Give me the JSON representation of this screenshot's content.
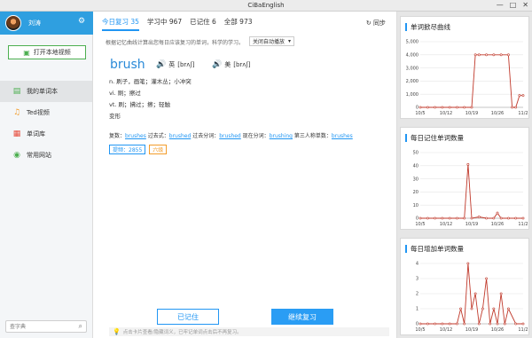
{
  "window": {
    "title": "CiBaEnglish",
    "controls": [
      "—",
      "□",
      "✕"
    ]
  },
  "sidebar": {
    "username": "刘涛",
    "open_video_label": "打开本地视频",
    "items": [
      {
        "label": "我的单词本",
        "icon": "book-icon",
        "glyph": "▤",
        "color": "#4caf50",
        "active": true
      },
      {
        "label": "Ted视频",
        "icon": "headphones-icon",
        "glyph": "♫",
        "color": "#f39c2a",
        "active": false
      },
      {
        "label": "单词库",
        "icon": "library-icon",
        "glyph": "▦",
        "color": "#e74c3c",
        "active": false
      },
      {
        "label": "常用网站",
        "icon": "globe-icon",
        "glyph": "◉",
        "color": "#4caf50",
        "active": false
      }
    ],
    "search_placeholder": "查字典"
  },
  "main": {
    "tabs": [
      {
        "label": "今日复习 35",
        "active": true
      },
      {
        "label": "学习中 967",
        "active": false
      },
      {
        "label": "已记住 6",
        "active": false
      },
      {
        "label": "全部 973",
        "active": false
      }
    ],
    "sync_label": "同步",
    "hint": "根据记忆曲线计算出您每日应该复习的单词，科学的学习。",
    "mode_select": "关闭自动播放",
    "word": "brush",
    "phonetics": [
      {
        "region": "英",
        "ipa": "[brʌʃ]"
      },
      {
        "region": "美",
        "ipa": "[brʌʃ]"
      }
    ],
    "definitions": [
      "n. 刷子，画笔；灌木丛；小冲突",
      "vi. 刷；擦过",
      "vt. 刷；拂过；擦；轻触"
    ],
    "forms_heading": "变形",
    "forms": {
      "plural_label": "复数：",
      "plural": "brushes",
      "past_label": "过去式：",
      "past": "brushed",
      "pp_label": "过去分词：",
      "pp": "brushed",
      "ing_label": "现在分词：",
      "ing": "brushing",
      "third_label": "第三人称单数：",
      "third": "brushes"
    },
    "badges": [
      "提频：2855",
      "六级"
    ],
    "remembered_button": "已记住",
    "continue_button": "继续复习",
    "tip": "点击卡片查看/隐藏词义，已牢记单词点击后不再复习。"
  },
  "charts": [
    {
      "title": "单词掀尽曲线"
    },
    {
      "title": "每日记住单词数量"
    },
    {
      "title": "每日增加单词数量"
    }
  ],
  "chart_data": [
    {
      "type": "line",
      "title": "单词掀尽曲线",
      "x_ticks": [
        "10/5",
        "10/12",
        "10/19",
        "10/26",
        "11/2"
      ],
      "ylim": [
        0,
        5000
      ],
      "y_ticks": [
        0,
        1000,
        2000,
        3000,
        4000,
        5000
      ],
      "y_tick_labels": [
        "0",
        "1,000",
        "2,000",
        "3,000",
        "4,000",
        "5,000"
      ],
      "x": [
        0,
        2,
        4,
        6,
        8,
        10,
        12,
        14,
        15,
        16,
        18,
        20,
        22,
        24,
        25,
        26,
        27,
        28
      ],
      "values": [
        0,
        0,
        0,
        0,
        0,
        0,
        0,
        0,
        4000,
        4000,
        4000,
        4000,
        4000,
        4000,
        0,
        0,
        900,
        900
      ],
      "color": "#c0392b"
    },
    {
      "type": "line",
      "title": "每日记住单词数量",
      "x_ticks": [
        "10/5",
        "10/12",
        "10/19",
        "10/26",
        "11/2"
      ],
      "ylim": [
        0,
        50
      ],
      "y_ticks": [
        0,
        10,
        20,
        30,
        40,
        50
      ],
      "y_tick_labels": [
        "0",
        "10",
        "20",
        "30",
        "40",
        "50"
      ],
      "x": [
        0,
        2,
        4,
        6,
        8,
        10,
        12,
        13,
        14,
        16,
        18,
        20,
        21,
        22,
        24,
        26,
        28
      ],
      "values": [
        0,
        0,
        0,
        0,
        0,
        0,
        0,
        41,
        0,
        1,
        0,
        0,
        4,
        0,
        0,
        0,
        0
      ],
      "color": "#c0392b"
    },
    {
      "type": "line",
      "title": "每日增加单词数量",
      "x_ticks": [
        "10/5",
        "10/12",
        "10/19",
        "10/26",
        "11/2"
      ],
      "ylim": [
        0,
        4
      ],
      "y_ticks": [
        0,
        1,
        2,
        3,
        4
      ],
      "y_tick_labels": [
        "0",
        "1",
        "2",
        "3",
        "4"
      ],
      "x": [
        0,
        2,
        4,
        6,
        8,
        10,
        11,
        12,
        13,
        14,
        15,
        16,
        17,
        18,
        19,
        20,
        21,
        22,
        23,
        24,
        26,
        28
      ],
      "values": [
        0,
        0,
        0,
        0,
        0,
        0,
        1,
        0,
        4,
        1,
        2,
        0,
        1,
        3,
        0,
        1,
        0,
        2,
        0,
        1,
        0,
        0
      ],
      "color": "#c0392b"
    }
  ]
}
